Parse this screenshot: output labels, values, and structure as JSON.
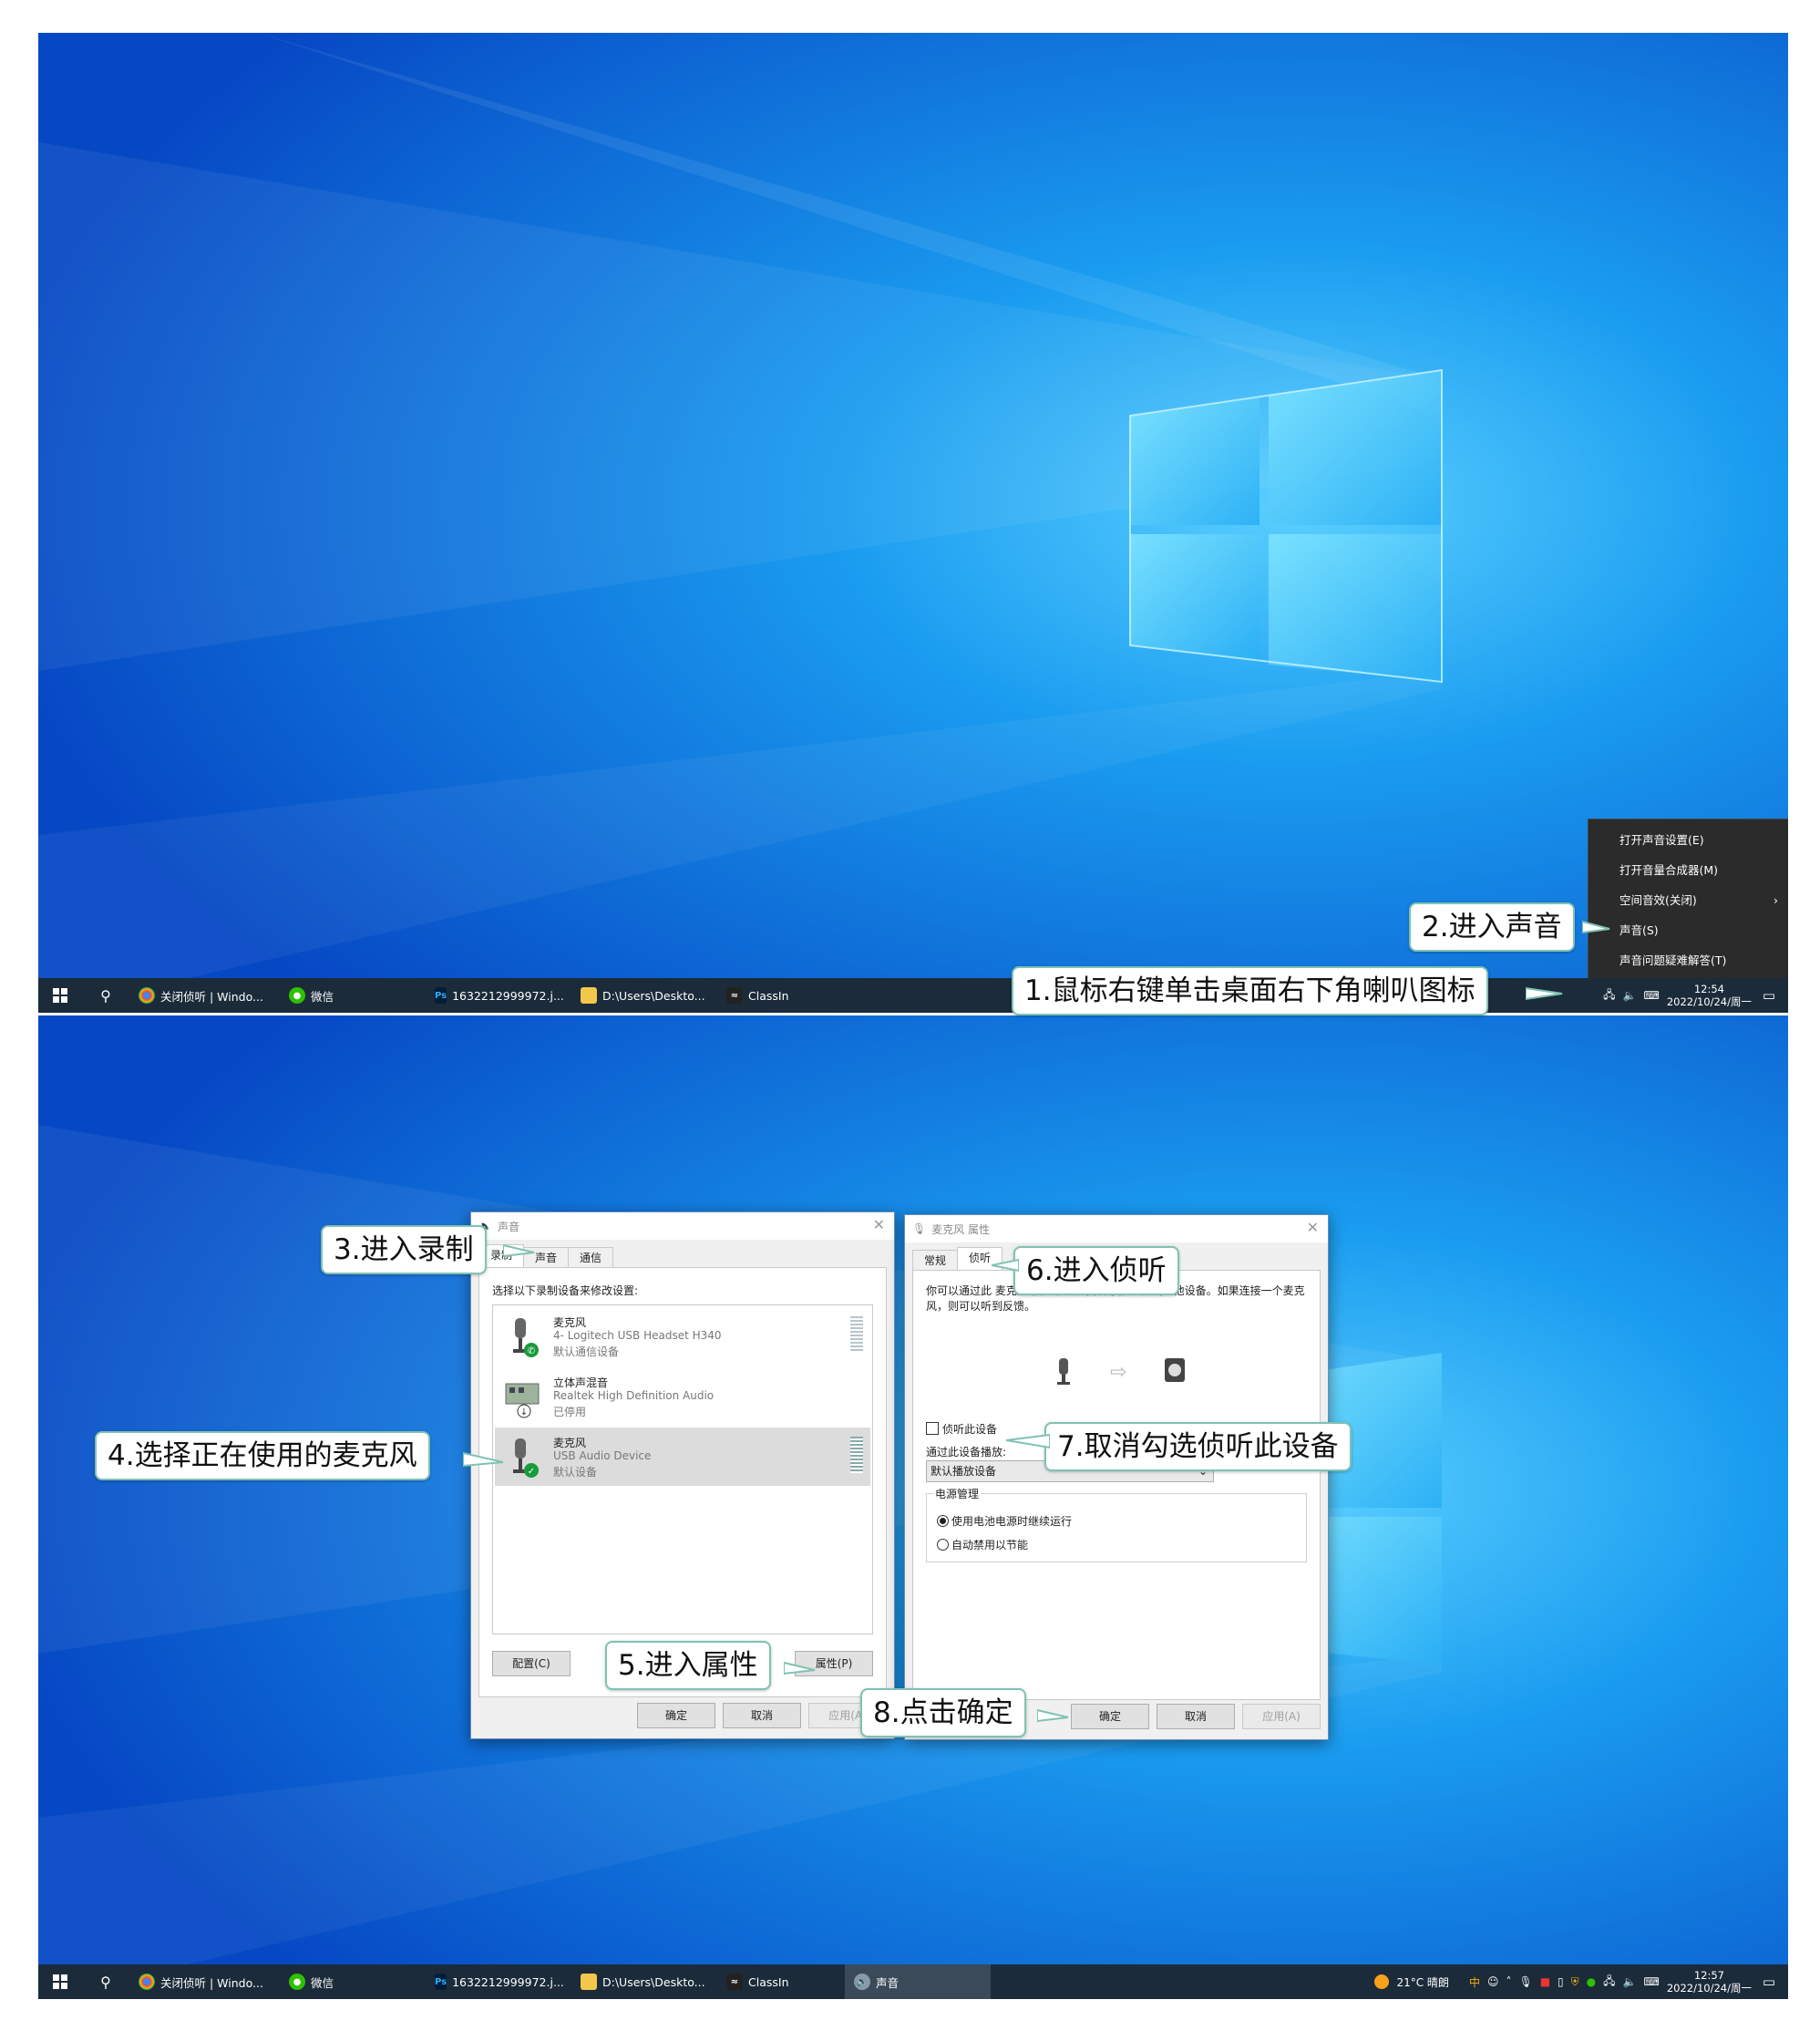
{
  "screen1": {
    "taskbar": {
      "apps": [
        {
          "icon": "chrome-icon",
          "label": "关闭侦听 | Windo..."
        },
        {
          "icon": "wechat-icon",
          "label": "微信"
        },
        {
          "icon": "photoshop-icon",
          "label": "1632212999972.j..."
        },
        {
          "icon": "folder-icon",
          "label": "D:\\Users\\Deskto..."
        },
        {
          "icon": "classin-icon",
          "label": "ClassIn"
        }
      ],
      "time": "12:54",
      "date": "2022/10/24/周一"
    },
    "context_menu": [
      {
        "label": "打开声音设置(E)"
      },
      {
        "label": "打开音量合成器(M)"
      },
      {
        "label": "空间音效(关闭)",
        "submenu": true
      },
      {
        "label": "声音(S)"
      },
      {
        "label": "声音问题疑难解答(T)"
      }
    ]
  },
  "screen2": {
    "taskbar": {
      "apps": [
        {
          "icon": "chrome-icon",
          "label": "关闭侦听 | Windo..."
        },
        {
          "icon": "wechat-icon",
          "label": "微信"
        },
        {
          "icon": "photoshop-icon",
          "label": "1632212999972.j..."
        },
        {
          "icon": "folder-icon",
          "label": "D:\\Users\\Deskto..."
        },
        {
          "icon": "classin-icon",
          "label": "ClassIn"
        },
        {
          "icon": "sound-icon",
          "label": "声音"
        }
      ],
      "weather": "21°C 晴朗",
      "time": "12:57",
      "date": "2022/10/24/周一"
    },
    "sound_dialog": {
      "title": "声音",
      "tabs": [
        "录制",
        "声音",
        "通信"
      ],
      "active_tab": "录制",
      "instruction": "选择以下录制设备来修改设置:",
      "devices": [
        {
          "name": "麦克风",
          "desc": "4- Logitech USB Headset H340",
          "status": "默认通信设备"
        },
        {
          "name": "立体声混音",
          "desc": "Realtek High Definition Audio",
          "status": "已停用"
        },
        {
          "name": "麦克风",
          "desc": "USB Audio Device",
          "status": "默认设备",
          "selected": true
        }
      ],
      "configure_button": "配置(C)",
      "properties_button": "属性(P)",
      "ok_button": "确定",
      "cancel_button": "取消",
      "apply_button": "应用(A)"
    },
    "mic_dialog": {
      "title": "麦克风 属性",
      "tabs": [
        "常规",
        "侦听"
      ],
      "active_tab": "侦听",
      "description": "你可以通过此 麦克风 插座收听便携音乐播放器或其他设备。如果连接一个麦克风，则可以听到反馈。",
      "listen_checkbox": "侦听此设备",
      "playback_label": "通过此设备播放:",
      "playback_value": "默认播放设备",
      "power_group": "电源管理",
      "radio_options": [
        "使用电池电源时继续运行",
        "自动禁用以节能"
      ],
      "ok_button": "确定",
      "cancel_button": "取消",
      "apply_button": "应用(A)"
    }
  },
  "callouts": {
    "c1": "1.鼠标右键单击桌面右下角喇叭图标",
    "c2": "2.进入声音",
    "c3": "3.进入录制",
    "c4": "4.选择正在使用的麦克风",
    "c5": "5.进入属性",
    "c6": "6.进入侦听",
    "c7": "7.取消勾选侦听此设备",
    "c8": "8.点击确定"
  },
  "colors": {
    "desktop_blue": "#0a6fd6",
    "taskbar": "#1b2b3a",
    "callout_border": "#7fc2b3",
    "menu_bg": "#2b2b2b"
  }
}
